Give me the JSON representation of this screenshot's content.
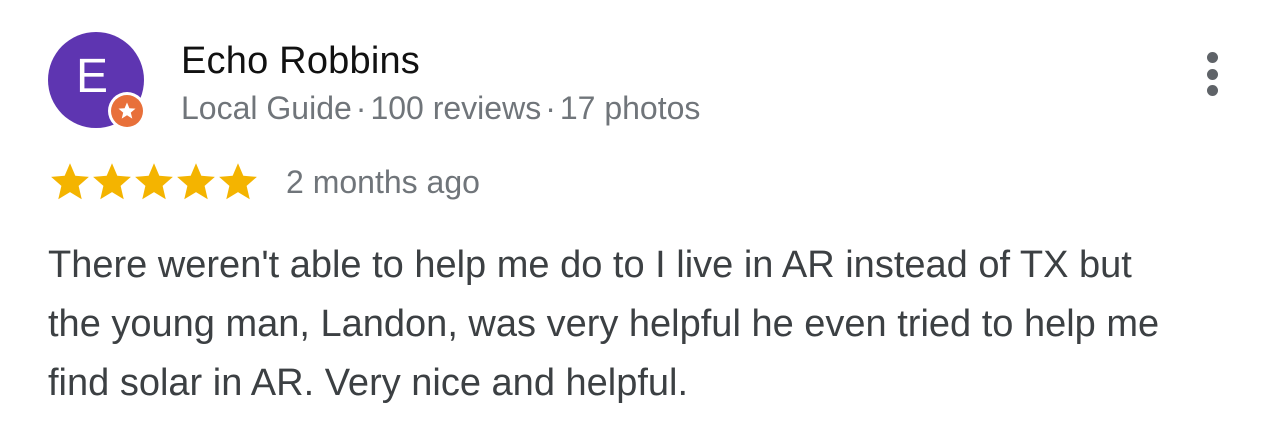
{
  "reviewer": {
    "initial": "E",
    "name": "Echo Robbins",
    "badge": "Local Guide",
    "separator": "·",
    "reviews": "100 reviews",
    "photos": "17 photos",
    "avatar_color": "#5e35b1",
    "badge_color": "#e8703a"
  },
  "review": {
    "rating": 5,
    "max_rating": 5,
    "star_color": "#f4b400",
    "date": "2 months ago",
    "text": "There weren't able to help me do to I live in AR instead of TX but the young man, Landon, was very helpful he even tried to help me find solar in AR. Very nice and helpful."
  },
  "icons": {
    "more": "more-vertical-icon",
    "star": "star-icon",
    "badge": "local-guide-badge-icon"
  }
}
